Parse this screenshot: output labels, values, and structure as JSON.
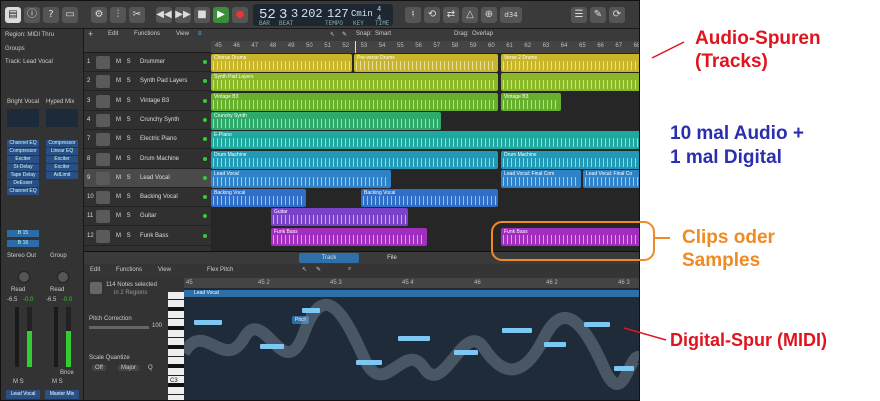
{
  "control_bar": {
    "lcd_bar": "52",
    "lcd_beat": "3",
    "lcd_div": "3",
    "lcd_tick": "202",
    "tempo": "127",
    "key": "Cmin",
    "signature_top": "4",
    "signature_bottom": "4",
    "count_in": "d34",
    "lcd_small": [
      "BAR",
      "BEAT",
      "TEMPO",
      "KEY",
      "TIME"
    ]
  },
  "inspector": {
    "region_label": "Region: MIDI Thru",
    "groups_label": "Groups",
    "track_label": "Track: Lead Vocal",
    "channels": [
      {
        "preset": "Bright Vocal",
        "slots": [
          "Channel EQ",
          "Compressor",
          "Exciter",
          "St-Delay",
          "Tape Delay",
          "DeEsser",
          "Channel EQ"
        ],
        "sends": [
          "B 15",
          "B 16"
        ],
        "output": "Stereo Out",
        "read": "Read",
        "vol": "-6.5",
        "pan": "-0.0",
        "name": "Lead Vocal",
        "ms": "M S"
      },
      {
        "preset": "Hyped Mix",
        "slots": [
          "Compressor",
          "Linear EQ",
          "Exciter",
          "Exciter",
          "AdLimit"
        ],
        "sends": [],
        "output": "Group",
        "read": "Read",
        "vol": "-6.5",
        "pan": "-0.0",
        "name": "Master Mix",
        "ms": "M S",
        "bounce": "Bnce"
      }
    ]
  },
  "tracks_header": {
    "edit": "Edit",
    "functions": "Functions",
    "view": "View",
    "snap_label": "Snap:",
    "snap_value": "Smart",
    "drag_label": "Drag:",
    "drag_value": "Overlap"
  },
  "ruler_marks": [
    "45",
    "46",
    "47",
    "48",
    "49",
    "50",
    "51",
    "52",
    "53",
    "54",
    "55",
    "56",
    "57",
    "58",
    "59",
    "60",
    "61",
    "62",
    "63",
    "64",
    "65",
    "66",
    "67",
    "68"
  ],
  "tracks": [
    {
      "num": "1",
      "name": "Drummer",
      "ms": "M S"
    },
    {
      "num": "2",
      "name": "Synth Pad Layers",
      "ms": "M S"
    },
    {
      "num": "3",
      "name": "Vintage B3",
      "ms": "M S"
    },
    {
      "num": "4",
      "name": "Crunchy Synth",
      "ms": "M S"
    },
    {
      "num": "7",
      "name": "Electric Piano",
      "ms": "M S"
    },
    {
      "num": "8",
      "name": "Drum Machine",
      "ms": "M S"
    },
    {
      "num": "9",
      "name": "Lead Vocal",
      "ms": "M S"
    },
    {
      "num": "10",
      "name": "Backing Vocal",
      "ms": "M S"
    },
    {
      "num": "11",
      "name": "Guitar",
      "ms": "M S"
    },
    {
      "num": "12",
      "name": "Funk Bass",
      "ms": "M S"
    }
  ],
  "regions": [
    {
      "row": 0,
      "start": 0,
      "end": 141,
      "name": "Chorus Drums",
      "color": "#c9b52a"
    },
    {
      "row": 0,
      "start": 143,
      "end": 287,
      "name": "Pre-verse Drums",
      "color": "#c9b52a"
    },
    {
      "row": 0,
      "start": 290,
      "end": 430,
      "name": "Verse 2 Drums",
      "color": "#c9b52a"
    },
    {
      "row": 1,
      "start": 0,
      "end": 287,
      "name": "Synth Pad Layers",
      "color": "#8ab828"
    },
    {
      "row": 1,
      "start": 290,
      "end": 430,
      "name": "",
      "color": "#8ab828"
    },
    {
      "row": 2,
      "start": 0,
      "end": 287,
      "name": "Vintage B3",
      "color": "#66b02d"
    },
    {
      "row": 2,
      "start": 290,
      "end": 350,
      "name": "Vintage B3",
      "color": "#66b02d"
    },
    {
      "row": 3,
      "start": 0,
      "end": 230,
      "name": "Crunchy Synth",
      "color": "#2eab6a"
    },
    {
      "row": 4,
      "start": 0,
      "end": 430,
      "name": "E-Piano",
      "color": "#1fa7a0"
    },
    {
      "row": 5,
      "start": 0,
      "end": 287,
      "name": "Drum Machine",
      "color": "#239ab5"
    },
    {
      "row": 5,
      "start": 290,
      "end": 430,
      "name": "Drum Machine",
      "color": "#239ab5"
    },
    {
      "row": 6,
      "start": 0,
      "end": 180,
      "name": "Lead Vocal",
      "color": "#2f82c8"
    },
    {
      "row": 6,
      "start": 290,
      "end": 370,
      "name": "Lead Vocal: Final Com",
      "color": "#2f82c8"
    },
    {
      "row": 6,
      "start": 372,
      "end": 430,
      "name": "Lead Vocal: Final Co",
      "color": "#2f82c8"
    },
    {
      "row": 7,
      "start": 0,
      "end": 95,
      "name": "Backing Vocal",
      "color": "#2f6fc8"
    },
    {
      "row": 7,
      "start": 150,
      "end": 287,
      "name": "Backing Vocal",
      "color": "#2f6fc8"
    },
    {
      "row": 8,
      "start": 60,
      "end": 197,
      "name": "Guitar",
      "color": "#7a42c8"
    },
    {
      "row": 9,
      "start": 60,
      "end": 216,
      "name": "Funk Bass",
      "color": "#a02fc0"
    },
    {
      "row": 9,
      "start": 290,
      "end": 430,
      "name": "Funk Bass",
      "color": "#a02fc0"
    }
  ],
  "editor": {
    "tab_track": "Track",
    "tab_file": "File",
    "edit": "Edit",
    "functions": "Functions",
    "view": "View",
    "mode": "Flex Pitch",
    "notes_selected": "114 Notes selected",
    "regions_info": "in 2 Regions",
    "pitch_correction": "Pitch Correction",
    "pitch_value": "100",
    "scale_quantize": "Scale Quantize",
    "sq_off": "Off",
    "sq_major": "Major",
    "ruler": [
      "45",
      "45 2",
      "45 3",
      "45 4",
      "46",
      "46 2",
      "46 3"
    ],
    "region_name": "Lead Vocal",
    "note_tooltip": "Pitch",
    "key_label": "C3"
  },
  "annotations": [
    {
      "line1": "Audio-Spuren",
      "line2": "(Tracks)",
      "color": "#e0141e"
    },
    {
      "line1": "10 mal Audio +",
      "line2": "1 mal Digital",
      "color": "#2b2fae"
    },
    {
      "line1": "Clips oder",
      "line2": "Samples",
      "color": "#f08a24"
    },
    {
      "line1": "Digital-Spur (MIDI)",
      "line2": "",
      "color": "#e0141e"
    }
  ]
}
